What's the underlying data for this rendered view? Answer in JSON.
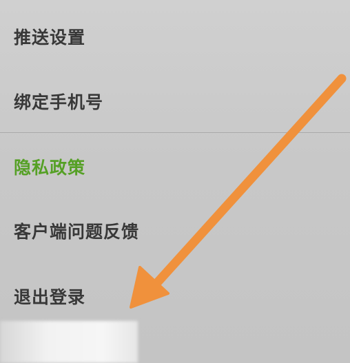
{
  "menu": {
    "items": [
      {
        "label": "推送设置"
      },
      {
        "label": "绑定手机号"
      },
      {
        "label": "隐私政策"
      },
      {
        "label": "客户端问题反馈"
      },
      {
        "label": "退出登录"
      }
    ]
  },
  "colors": {
    "background": "#c9c9c9",
    "text": "#383838",
    "highlight": "#55a025",
    "divider": "#a9a9a9",
    "arrow": "#f0913c"
  },
  "icons": {
    "annotation": "arrow-down-left-icon"
  }
}
